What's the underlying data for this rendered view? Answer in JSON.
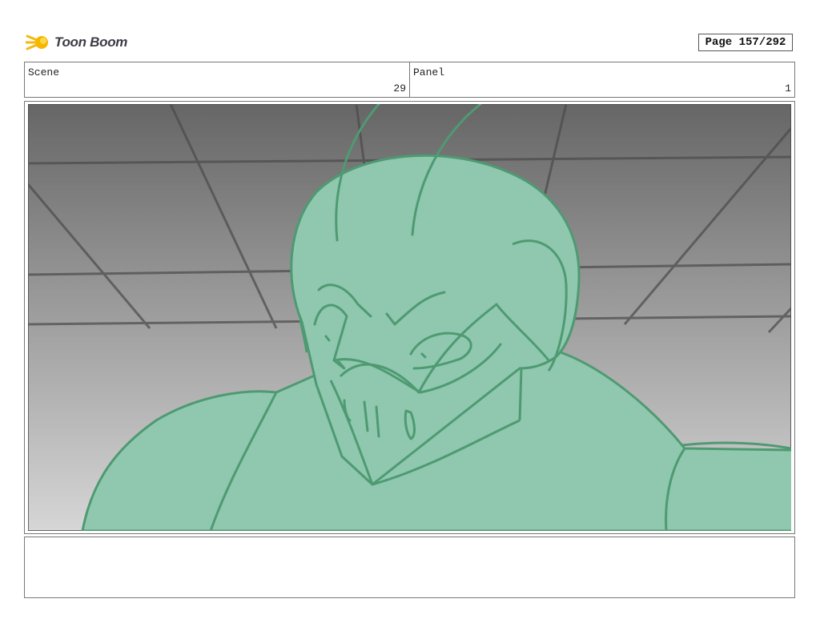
{
  "logo": {
    "brand": "Toon Boom",
    "icon": "toon-boom-flame-icon"
  },
  "page": {
    "label": "Page 157/292"
  },
  "scene": {
    "label": "Scene",
    "value": "29"
  },
  "panel": {
    "label": "Panel",
    "value": "1"
  },
  "colors": {
    "character_fill": "#8fc8ae",
    "character_line": "#4e9a72",
    "bg_top": "#666666",
    "bg_bottom": "#d6d6d6"
  }
}
